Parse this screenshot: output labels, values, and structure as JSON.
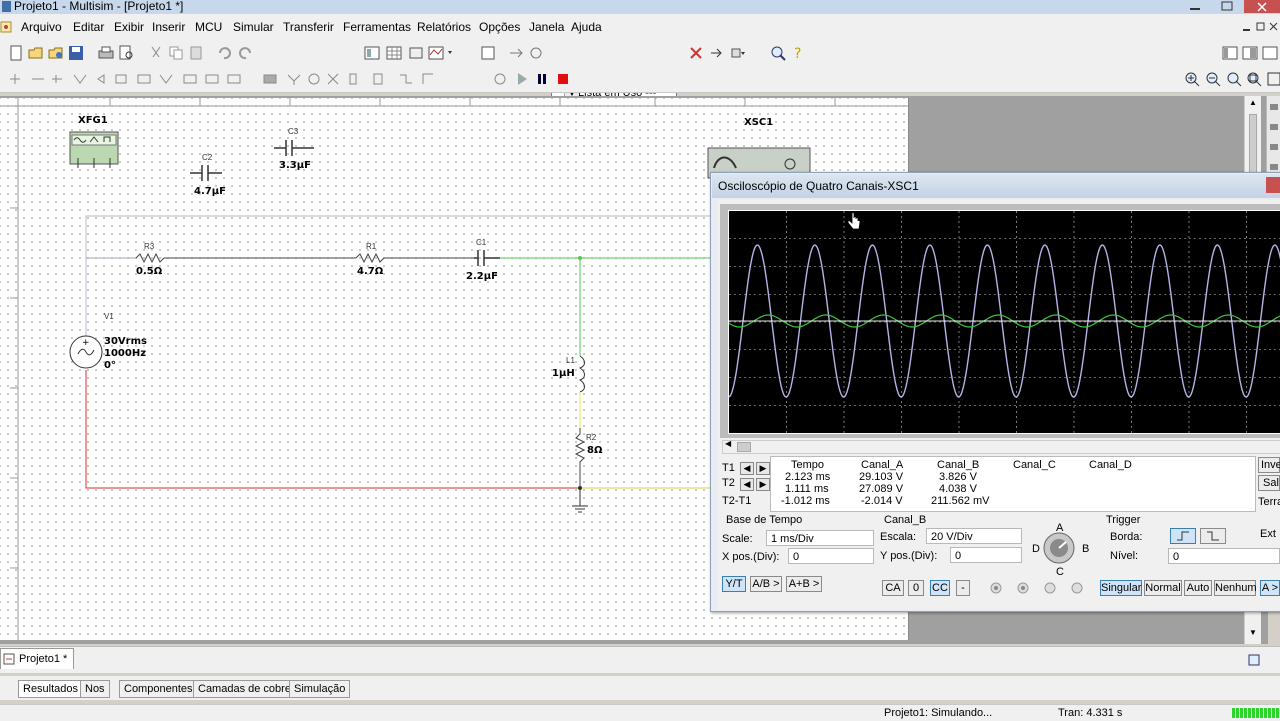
{
  "window": {
    "title": "Projeto1 - Multisim - [Projeto1 *]"
  },
  "menu": [
    "Arquivo",
    "Editar",
    "Exibir",
    "Inserir",
    "MCU",
    "Simular",
    "Transferir",
    "Ferramentas",
    "Relatórios",
    "Opções",
    "Janela",
    "Ajuda"
  ],
  "toolbar": {
    "in_use_list": "--- Lista em Uso ---"
  },
  "schematic": {
    "xfg1": "XFG1",
    "xsc1": "XSC1",
    "c2": {
      "ref": "C2",
      "value": "4.7µF"
    },
    "c3": {
      "ref": "C3",
      "value": "3.3µF"
    },
    "r3": {
      "ref": "R3",
      "value": "0.5Ω"
    },
    "r1": {
      "ref": "R1",
      "value": "4.7Ω"
    },
    "c1": {
      "ref": "C1",
      "value": "2.2µF"
    },
    "v1": {
      "ref": "V1",
      "line1": "30Vrms",
      "line2": "1000Hz",
      "line3": "0°"
    },
    "l1": {
      "ref": "L1",
      "value": "1µH"
    },
    "r2": {
      "ref": "R2",
      "value": "8Ω"
    }
  },
  "scope": {
    "title": "Osciloscópio de Quatro Canais-XSC1",
    "colors": {
      "channel_a": "#b4b4e6",
      "channel_b": "#3cc83c"
    },
    "meas_headers": [
      "Tempo",
      "Canal_A",
      "Canal_B",
      "Canal_C",
      "Canal_D"
    ],
    "rows": [
      {
        "label": "T1",
        "tempo": "2.123 ms",
        "a": "29.103 V",
        "b": "3.826 V"
      },
      {
        "label": "T2",
        "tempo": "1.111 ms",
        "a": "27.089 V",
        "b": "4.038 V"
      },
      {
        "label": "T2-T1",
        "tempo": "-1.012 ms",
        "a": "-2.014 V",
        "b": "211.562 mV"
      }
    ],
    "side_buttons": [
      "Inve",
      "Sal",
      "Terra"
    ],
    "timebase": {
      "label": "Base de Tempo",
      "scale_label": "Scale:",
      "scale": "1 ms/Div",
      "xpos_label": "X pos.(Div):",
      "xpos": "0",
      "modes": [
        "Y/T",
        "A/B >",
        "A+B >"
      ]
    },
    "channel": {
      "label": "Canal_B",
      "scale_label": "Escala:",
      "scale": "20  V/Div",
      "ypos_label": "Y pos.(Div):",
      "ypos": "0",
      "coupling": [
        "CA",
        "0",
        "CC",
        "-"
      ],
      "knob": [
        "A",
        "B",
        "C",
        "D"
      ]
    },
    "trigger": {
      "label": "Trigger",
      "edge_label": "Borda:",
      "level_label": "Nível:",
      "level": "0",
      "ext": "Ext",
      "modes": [
        "Singular",
        "Normal",
        "Auto",
        "Nenhum",
        "A >"
      ]
    }
  },
  "tabs": {
    "doc": "Projeto1 *",
    "bottom": [
      "Resultados",
      "Nos",
      "Componentes",
      "Camadas de cobre",
      "Simulação"
    ]
  },
  "status": {
    "main": "Projeto1: Simulando...",
    "tran": "Tran: 4.331 s"
  }
}
